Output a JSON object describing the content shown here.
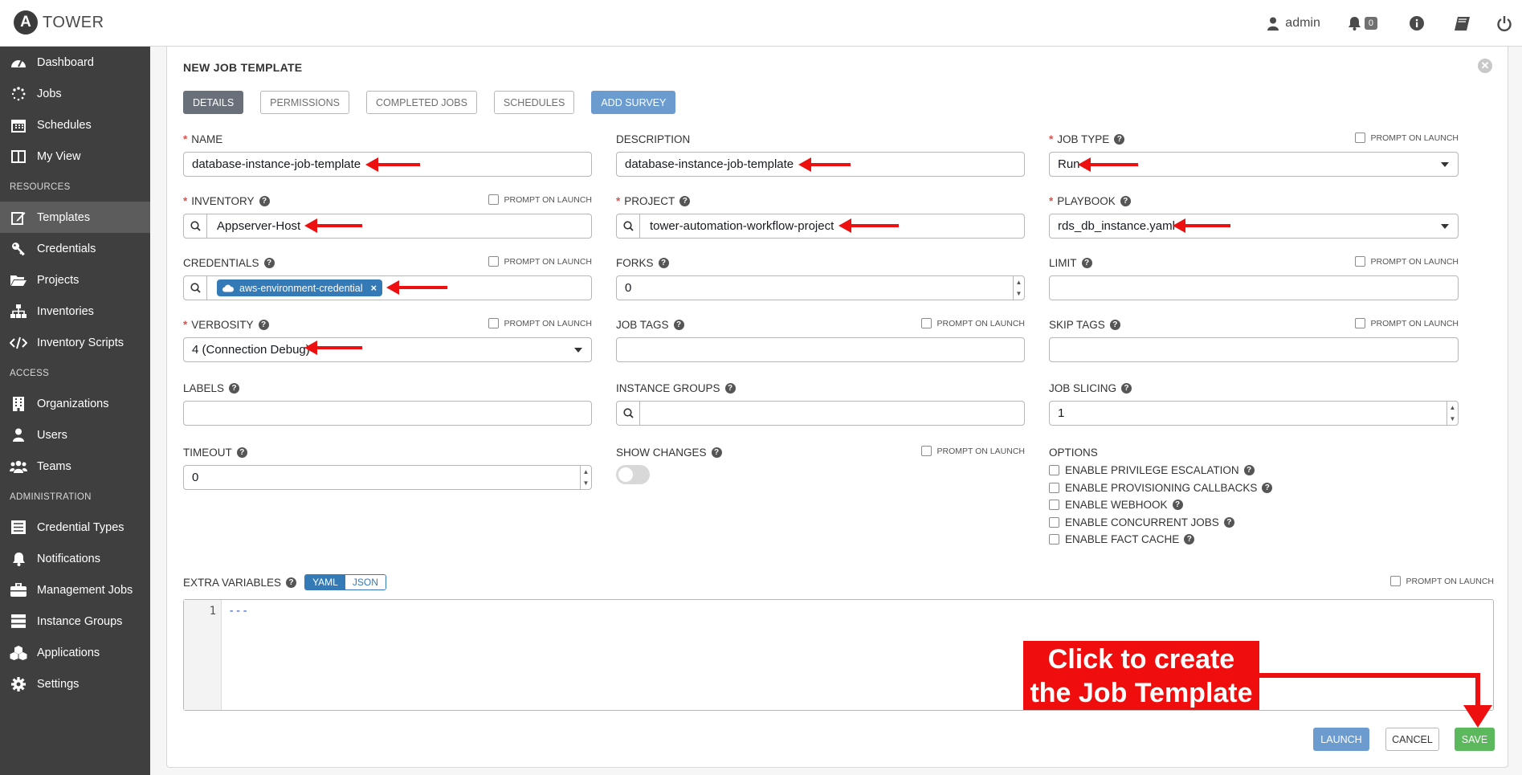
{
  "app": {
    "logo_letter": "A",
    "name": "TOWER"
  },
  "header": {
    "user": "admin",
    "notification_count": "0"
  },
  "sidebar": {
    "items_top": [
      {
        "label": "Dashboard",
        "icon": "dashboard-icon"
      },
      {
        "label": "Jobs",
        "icon": "spinner-icon"
      },
      {
        "label": "Schedules",
        "icon": "calendar-icon"
      },
      {
        "label": "My View",
        "icon": "columns-icon"
      }
    ],
    "section_resources": "RESOURCES",
    "items_resources": [
      {
        "label": "Templates",
        "icon": "pencil-icon"
      },
      {
        "label": "Credentials",
        "icon": "key-icon"
      },
      {
        "label": "Projects",
        "icon": "folder-icon"
      },
      {
        "label": "Inventories",
        "icon": "sitemap-icon"
      },
      {
        "label": "Inventory Scripts",
        "icon": "code-icon"
      }
    ],
    "section_access": "ACCESS",
    "items_access": [
      {
        "label": "Organizations",
        "icon": "building-icon"
      },
      {
        "label": "Users",
        "icon": "user-icon"
      },
      {
        "label": "Teams",
        "icon": "users-icon"
      }
    ],
    "section_admin": "ADMINISTRATION",
    "items_admin": [
      {
        "label": "Credential Types",
        "icon": "list-icon"
      },
      {
        "label": "Notifications",
        "icon": "bell-icon"
      },
      {
        "label": "Management Jobs",
        "icon": "briefcase-icon"
      },
      {
        "label": "Instance Groups",
        "icon": "server-icon"
      },
      {
        "label": "Applications",
        "icon": "cubes-icon"
      },
      {
        "label": "Settings",
        "icon": "gear-icon"
      }
    ]
  },
  "form": {
    "title": "NEW JOB TEMPLATE",
    "tabs": [
      "DETAILS",
      "PERMISSIONS",
      "COMPLETED JOBS",
      "SCHEDULES",
      "ADD SURVEY"
    ],
    "prompt_label": "PROMPT ON LAUNCH",
    "name": {
      "label": "NAME",
      "value": "database-instance-job-template"
    },
    "description": {
      "label": "DESCRIPTION",
      "value": "database-instance-job-template"
    },
    "job_type": {
      "label": "JOB TYPE",
      "value": "Run"
    },
    "inventory": {
      "label": "INVENTORY",
      "value": "Appserver-Host"
    },
    "project": {
      "label": "PROJECT",
      "value": "tower-automation-workflow-project"
    },
    "playbook": {
      "label": "PLAYBOOK",
      "value": "rds_db_instance.yaml"
    },
    "credentials": {
      "label": "CREDENTIALS",
      "chip": "aws-environment-credential"
    },
    "forks": {
      "label": "FORKS",
      "value": "0"
    },
    "limit": {
      "label": "LIMIT",
      "value": ""
    },
    "verbosity": {
      "label": "VERBOSITY",
      "value": "4 (Connection Debug)"
    },
    "job_tags": {
      "label": "JOB TAGS",
      "value": ""
    },
    "skip_tags": {
      "label": "SKIP TAGS",
      "value": ""
    },
    "labels": {
      "label": "LABELS",
      "value": ""
    },
    "instance_groups": {
      "label": "INSTANCE GROUPS",
      "value": ""
    },
    "job_slicing": {
      "label": "JOB SLICING",
      "value": "1"
    },
    "timeout": {
      "label": "TIMEOUT",
      "value": "0"
    },
    "show_changes": {
      "label": "SHOW CHANGES",
      "on": false
    },
    "options": {
      "label": "OPTIONS",
      "items": [
        "ENABLE PRIVILEGE ESCALATION",
        "ENABLE PROVISIONING CALLBACKS",
        "ENABLE WEBHOOK",
        "ENABLE CONCURRENT JOBS",
        "ENABLE FACT CACHE"
      ]
    },
    "extra_vars": {
      "label": "EXTRA VARIABLES",
      "yaml": "YAML",
      "json": "JSON",
      "line_number": "1",
      "code": "---"
    },
    "buttons": {
      "launch": "LAUNCH",
      "cancel": "CANCEL",
      "save": "SAVE"
    }
  },
  "annotation": {
    "line1": "Click to create",
    "line2": "the Job Template",
    "color": "#ee1010"
  }
}
